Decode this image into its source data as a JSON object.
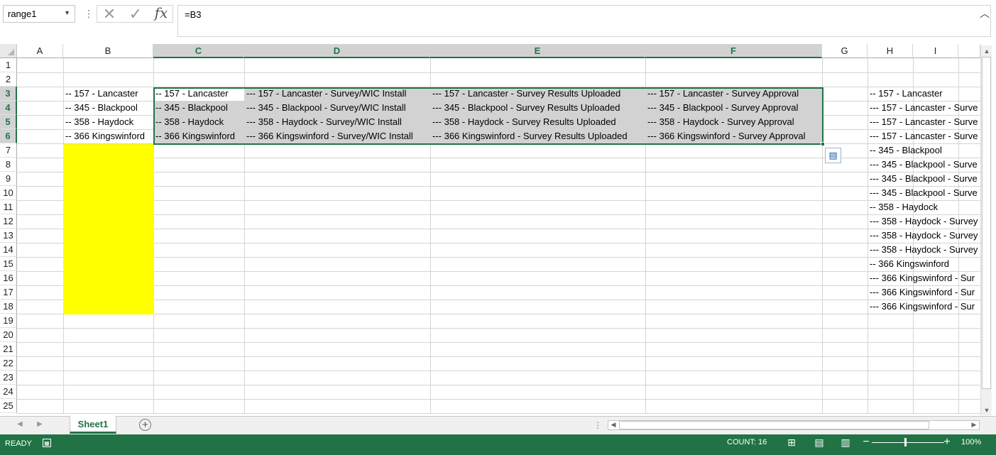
{
  "name_box": {
    "value": "range1"
  },
  "formula_bar": {
    "value": "=B3",
    "fx_label": "fx"
  },
  "columns": [
    "A",
    "B",
    "C",
    "D",
    "E",
    "F",
    "G",
    "H",
    "I"
  ],
  "rows": [
    "1",
    "2",
    "3",
    "4",
    "5",
    "6",
    "7",
    "8",
    "9",
    "10",
    "11",
    "12",
    "13",
    "14",
    "15",
    "16",
    "17",
    "18",
    "19",
    "20",
    "21",
    "22",
    "23",
    "24",
    "25"
  ],
  "cells": {
    "B3": "-- 157 - Lancaster",
    "B4": "-- 345 - Blackpool",
    "B5": "-- 358 - Haydock",
    "B6": "-- 366 Kingswinford",
    "C3": "-- 157 - Lancaster",
    "C4": "-- 345 - Blackpool",
    "C5": "-- 358 - Haydock",
    "C6": "-- 366 Kingswinford",
    "D3": "--- 157 - Lancaster - Survey/WIC Install",
    "D4": "--- 345 - Blackpool - Survey/WIC Install",
    "D5": "--- 358 - Haydock - Survey/WIC Install",
    "D6": "--- 366 Kingswinford - Survey/WIC Install",
    "E3": "--- 157 - Lancaster - Survey Results Uploaded",
    "E4": "--- 345 - Blackpool - Survey Results Uploaded",
    "E5": "--- 358 - Haydock - Survey Results Uploaded",
    "E6": "--- 366 Kingswinford - Survey Results Uploaded",
    "F3": "--- 157 - Lancaster - Survey Approval",
    "F4": "--- 345 - Blackpool - Survey Approval",
    "F5": "--- 358 - Haydock - Survey Approval",
    "F6": "--- 366 Kingswinford - Survey Approval",
    "H3": "-- 157 - Lancaster",
    "H4": "--- 157 - Lancaster - Surve",
    "H5": "--- 157 - Lancaster - Surve",
    "H6": "--- 157 - Lancaster - Surve",
    "H7": "-- 345 - Blackpool",
    "H8": "--- 345 - Blackpool - Surve",
    "H9": "--- 345 - Blackpool - Surve",
    "H10": "--- 345 - Blackpool - Surve",
    "H11": "-- 358 - Haydock",
    "H12": "--- 358 - Haydock - Survey",
    "H13": "--- 358 - Haydock - Survey",
    "H14": "--- 358 - Haydock - Survey",
    "H15": "-- 366 Kingswinford",
    "H16": "--- 366 Kingswinford - Sur",
    "H17": "--- 366 Kingswinford - Sur",
    "H18": "--- 366 Kingswinford - Sur"
  },
  "sheet_tabs": [
    {
      "label": "Sheet1",
      "active": true
    }
  ],
  "status_bar": {
    "mode": "READY",
    "count": "COUNT: 16",
    "zoom": "100%"
  },
  "colors": {
    "accent": "#217346",
    "selection_fill": "#d2d2d2",
    "highlight": "#ffff00"
  }
}
